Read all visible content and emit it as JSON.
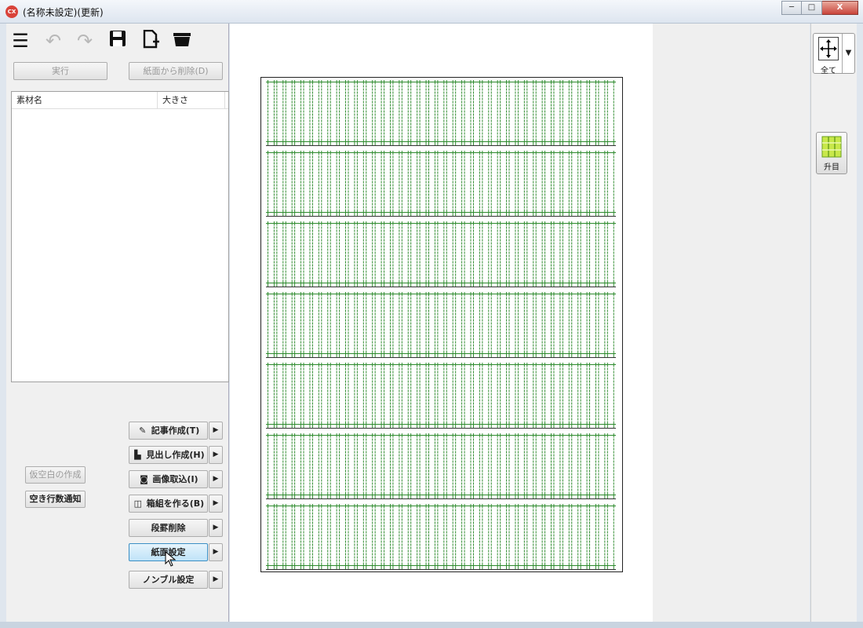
{
  "window": {
    "title": "(名称未設定)(更新)",
    "app_badge": "CX",
    "controls": [
      "─",
      "□",
      "X"
    ]
  },
  "toolbar": {
    "icons": [
      "menu-icon",
      "undo-icon",
      "redo-icon",
      "save-icon",
      "new-document-icon",
      "open-folder-icon"
    ]
  },
  "top_buttons": {
    "execute": "実行",
    "remove_from_page": "紙面から削除(D)"
  },
  "material_list": {
    "columns": [
      "素材名",
      "大きさ"
    ],
    "rows": []
  },
  "side_buttons": {
    "temp_blank": "仮空白の作成",
    "blank_lines_notice": "空き行数通知"
  },
  "commands": [
    {
      "label": "記事作成(T)",
      "icon": "pencil-icon"
    },
    {
      "label": "見出し作成(H)",
      "icon": "heading-icon"
    },
    {
      "label": "画像取込(I)",
      "icon": "camera-icon"
    },
    {
      "label": "箱組を作る(B)",
      "icon": "box-icon"
    },
    {
      "label": "段罫削除",
      "icon": ""
    },
    {
      "label": "紙面設定",
      "icon": ""
    },
    {
      "label": "ノンブル設定",
      "icon": ""
    }
  ],
  "right_toolbar": {
    "all_label": "全て",
    "grid_label": "升目"
  },
  "paper": {
    "band_count": 7,
    "grid_color": "#2c8a2c"
  }
}
